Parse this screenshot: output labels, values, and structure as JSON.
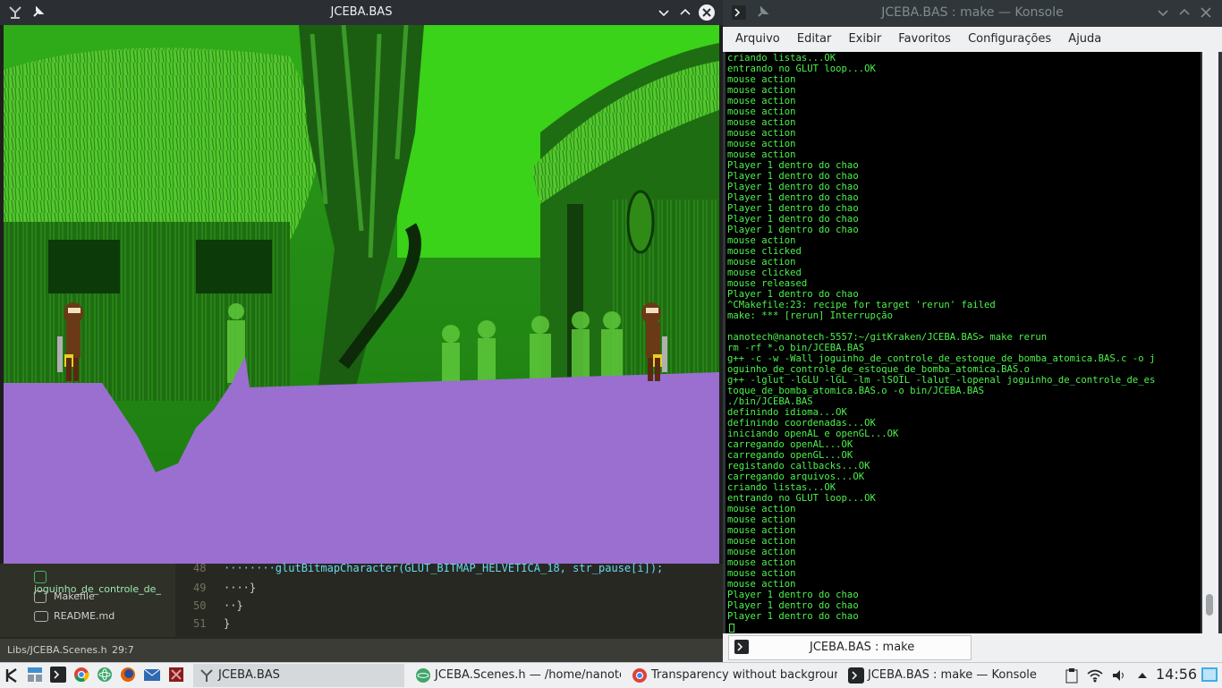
{
  "game_window": {
    "title": "JCEBA.BAS",
    "icon": "jceba-icon",
    "pin_icon": "pin-icon",
    "controls": [
      "chevron-down-icon",
      "chevron-up-icon",
      "close-icon"
    ]
  },
  "konsole": {
    "title": "JCEBA.BAS : make — Konsole",
    "menu": [
      "Arquivo",
      "Editar",
      "Exibir",
      "Favoritos",
      "Configurações",
      "Ajuda"
    ],
    "tab_label": "JCEBA.BAS : make",
    "lines": [
      "criando listas...OK",
      "entrando no GLUT loop...OK",
      "mouse action",
      "mouse action",
      "mouse action",
      "mouse action",
      "mouse action",
      "mouse action",
      "mouse action",
      "mouse action",
      "Player 1 dentro do chao",
      "Player 1 dentro do chao",
      "Player 1 dentro do chao",
      "Player 1 dentro do chao",
      "Player 1 dentro do chao",
      "Player 1 dentro do chao",
      "Player 1 dentro do chao",
      "mouse action",
      "mouse clicked",
      "mouse action",
      "mouse clicked",
      "mouse released",
      "Player 1 dentro do chao",
      "^CMakefile:23: recipe for target 'rerun' failed",
      "make: *** [rerun] Interrupção",
      "",
      "nanotech@nanotech-5557:~/gitKraken/JCEBA.BAS> make rerun",
      "rm -rf *.o bin/JCEBA.BAS",
      "g++ -c -w -Wall joguinho_de_controle_de_estoque_de_bomba_atomica.BAS.c -o j",
      "oguinho_de_controle_de_estoque_de_bomba_atomica.BAS.o",
      "g++ -lglut -lGLU -lGL -lm -lSOIL -lalut -lopenal joguinho_de_controle_de_es",
      "toque_de_bomba_atomica.BAS.o -o bin/JCEBA.BAS",
      "./bin/JCEBA.BAS",
      "definindo idioma...OK",
      "definindo coordenadas...OK",
      "iniciando openAL e openGL...OK",
      "carregando openAL...OK",
      "carregando openGL...OK",
      "registando callbacks...OK",
      "carregando arquivos...OK",
      "criando listas...OK",
      "entrando no GLUT loop...OK",
      "mouse action",
      "mouse action",
      "mouse action",
      "mouse action",
      "mouse action",
      "mouse action",
      "mouse action",
      "mouse action",
      "Player 1 dentro do chao",
      "Player 1 dentro do chao",
      "Player 1 dentro do chao"
    ],
    "colors": {
      "text": "#4cf24c",
      "background": "#000000"
    }
  },
  "editor": {
    "files": [
      "joguinho_de_controle_de_",
      "Makefile",
      "README.md"
    ],
    "line_numbers": [
      "48",
      "49",
      "50",
      "51"
    ],
    "code": [
      "········glutBitmapCharacter(GLUT_BITMAP_HELVETICA_18, str_pause[i]);",
      "····}",
      "··}",
      "}"
    ],
    "status_path": "Libs/JCEBA.Scenes.h",
    "status_pos": "29:7"
  },
  "taskbar": {
    "tasks": [
      {
        "label": "JCEBA.BAS",
        "icon": "jceba-icon"
      },
      {
        "label": "JCEBA.Scenes.h — /home/nanotec",
        "icon": "atom-icon"
      },
      {
        "label": "Transparency without backgroun",
        "icon": "chrome-icon"
      },
      {
        "label": "JCEBA.BAS : make — Konsole",
        "icon": "terminal-icon"
      }
    ],
    "clock": "14:56"
  }
}
